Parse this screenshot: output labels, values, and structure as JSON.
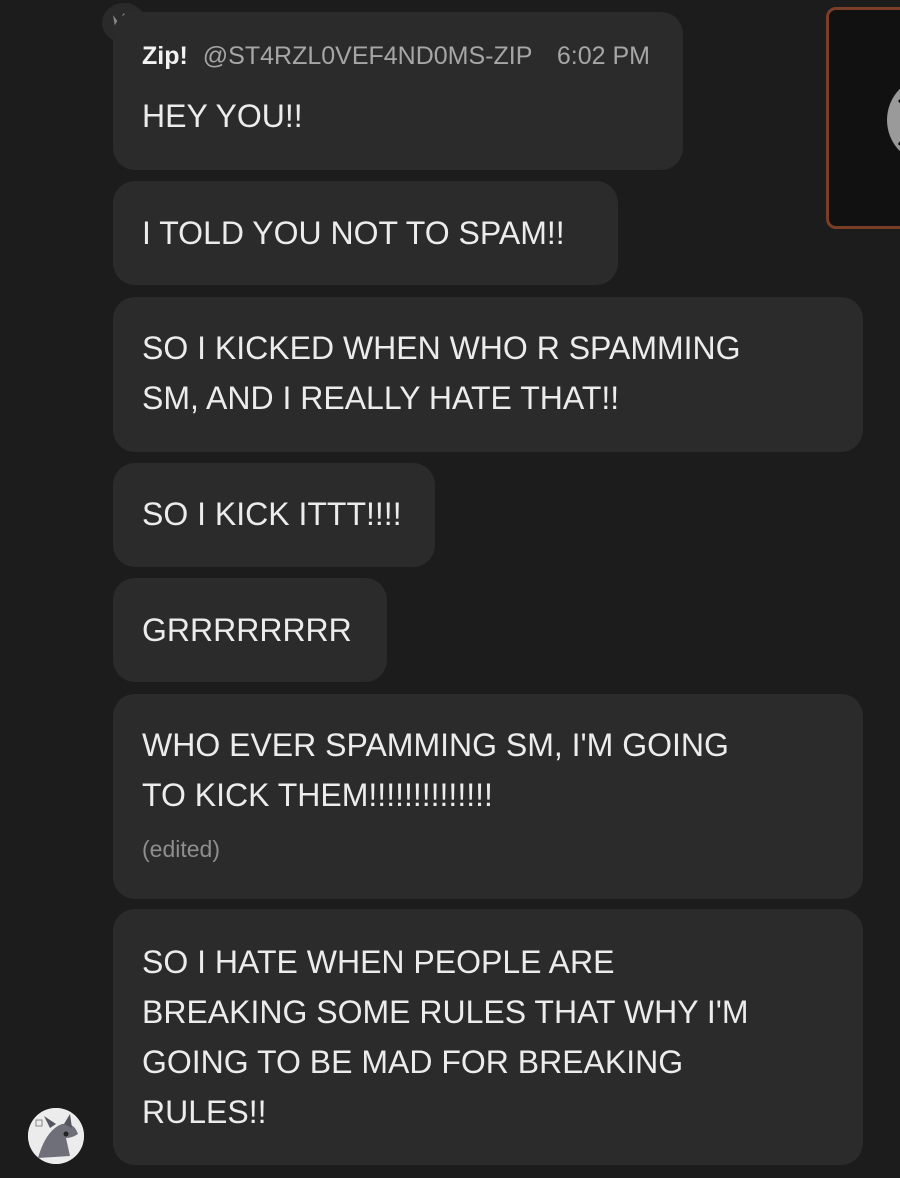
{
  "message": {
    "author": "Zip!",
    "handle": "@ST4RZL0VEF4ND0MS-ZIP",
    "time": "6:02 PM",
    "owner_badge_icon": "crown-icon"
  },
  "bubbles": [
    {
      "lines": [
        "HEY YOU!!"
      ]
    },
    {
      "lines": [
        "I TOLD YOU NOT TO SPAM!!"
      ]
    },
    {
      "lines": [
        "SO I KICKED WHEN WHO R SPAMMING",
        "SM, AND I REALLY HATE THAT!!"
      ]
    },
    {
      "lines": [
        "SO I KICK ITTT!!!!"
      ]
    },
    {
      "lines": [
        "GRRRRRRRR"
      ]
    },
    {
      "lines": [
        "WHO EVER SPAMMING SM, I'M GOING",
        "TO KICK THEM!!!!!!!!!!!!!!"
      ],
      "edited": "(edited)"
    },
    {
      "lines": [
        "SO I HATE WHEN PEOPLE ARE",
        "BREAKING SOME RULES THAT WHY I'M",
        "GOING TO BE MAD FOR BREAKING",
        "RULES!!"
      ]
    }
  ],
  "colors": {
    "background": "#1c1c1c",
    "bubble": "#2b2b2b",
    "text": "#ececec",
    "muted": "#a6a6a6",
    "image_border": "#7a3e26"
  }
}
